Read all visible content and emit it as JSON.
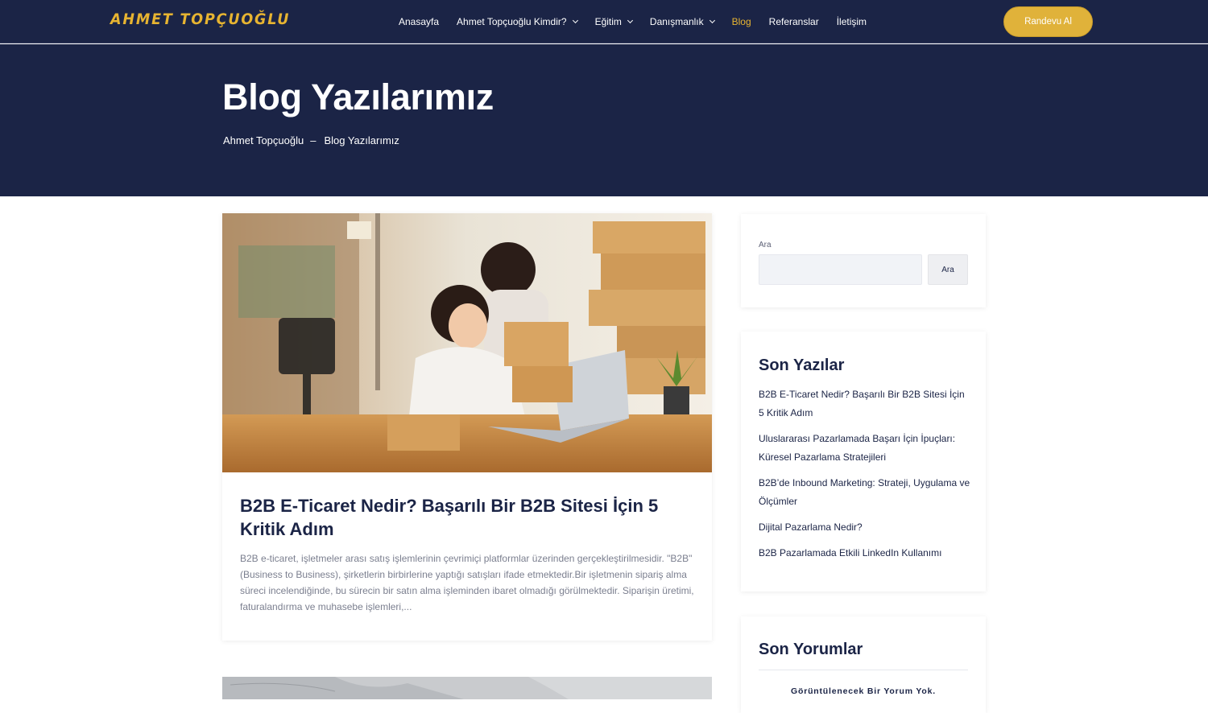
{
  "header": {
    "logo": "AHMET TOPÇUOĞLU",
    "nav": [
      {
        "label": "Anasayfa",
        "dropdown": false,
        "active": false
      },
      {
        "label": "Ahmet Topçuoğlu Kimdir?",
        "dropdown": true,
        "active": false
      },
      {
        "label": "Eğitim",
        "dropdown": true,
        "active": false
      },
      {
        "label": "Danışmanlık",
        "dropdown": true,
        "active": false
      },
      {
        "label": "Blog",
        "dropdown": false,
        "active": true
      },
      {
        "label": "Referanslar",
        "dropdown": false,
        "active": false
      },
      {
        "label": "İletişim",
        "dropdown": false,
        "active": false
      }
    ],
    "cta_label": "Randevu Al"
  },
  "hero": {
    "title": "Blog Yazılarımız",
    "breadcrumb": {
      "home": "Ahmet Topçuoğlu",
      "separator": "–",
      "current": "Blog Yazılarımız"
    }
  },
  "posts": [
    {
      "title": "B2B E-Ticaret Nedir? Başarılı Bir B2B Sitesi İçin 5 Kritik Adım",
      "excerpt": "B2B e-ticaret, işletmeler arası satış işlemlerinin çevrimiçi platformlar üzerinden gerçekleştirilmesidir. \"B2B\" (Business to Business), şirketlerin birbirlerine yaptığı satışları ifade etmektedir.Bir işletmenin sipariş alma süreci incelendiğinde, bu sürecin bir satın alma işleminden ibaret olmadığı görülmektedir. Siparişin üretimi, faturalandırma ve muhasebe işlemleri,..."
    }
  ],
  "sidebar": {
    "search": {
      "label": "Ara",
      "value": "",
      "button_label": "Ara"
    },
    "recent_posts": {
      "title": "Son Yazılar",
      "items": [
        "B2B E-Ticaret Nedir? Başarılı Bir B2B Sitesi İçin 5 Kritik Adım",
        "Uluslararası Pazarlamada Başarı İçin İpuçları: Küresel Pazarlama Stratejileri",
        "B2B’de Inbound Marketing: Strateji, Uygulama ve Ölçümler",
        "Dijital Pazarlama Nedir?",
        "B2B Pazarlamada Etkili LinkedIn Kullanımı"
      ]
    },
    "recent_comments": {
      "title": "Son Yorumlar",
      "empty_text": "Görüntülenecek Bir Yorum Yok."
    }
  },
  "colors": {
    "navy": "#1b2446",
    "gold": "#e0b23a",
    "text_muted": "#7b7f8f"
  }
}
